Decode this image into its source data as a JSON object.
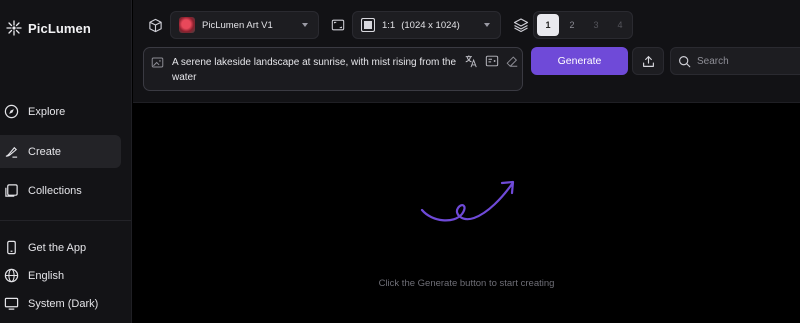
{
  "app": {
    "name": "PicLumen"
  },
  "sidebar": {
    "items": [
      {
        "label": "Explore",
        "icon": "compass-icon",
        "active": false
      },
      {
        "label": "Create",
        "icon": "brush-icon",
        "active": true
      },
      {
        "label": "Collections",
        "icon": "collections-icon",
        "active": false
      }
    ],
    "bottom": [
      {
        "label": "Get the App",
        "icon": "phone-icon"
      },
      {
        "label": "English",
        "icon": "globe-icon"
      },
      {
        "label": "System (Dark)",
        "icon": "monitor-icon"
      }
    ]
  },
  "toolbar": {
    "model": "PicLumen Art V1",
    "ratio": "1:1",
    "dimensions": "(1024 x 1024)",
    "counts": [
      "1",
      "2",
      "3",
      "4"
    ],
    "selected_count": "1",
    "generate_label": "Generate",
    "search_placeholder": "Search"
  },
  "prompt": {
    "value": "A serene lakeside landscape at sunrise, with mist rising from the water"
  },
  "main": {
    "empty_text": "Click the Generate button to start creating",
    "accent": "#6f4ad8"
  }
}
